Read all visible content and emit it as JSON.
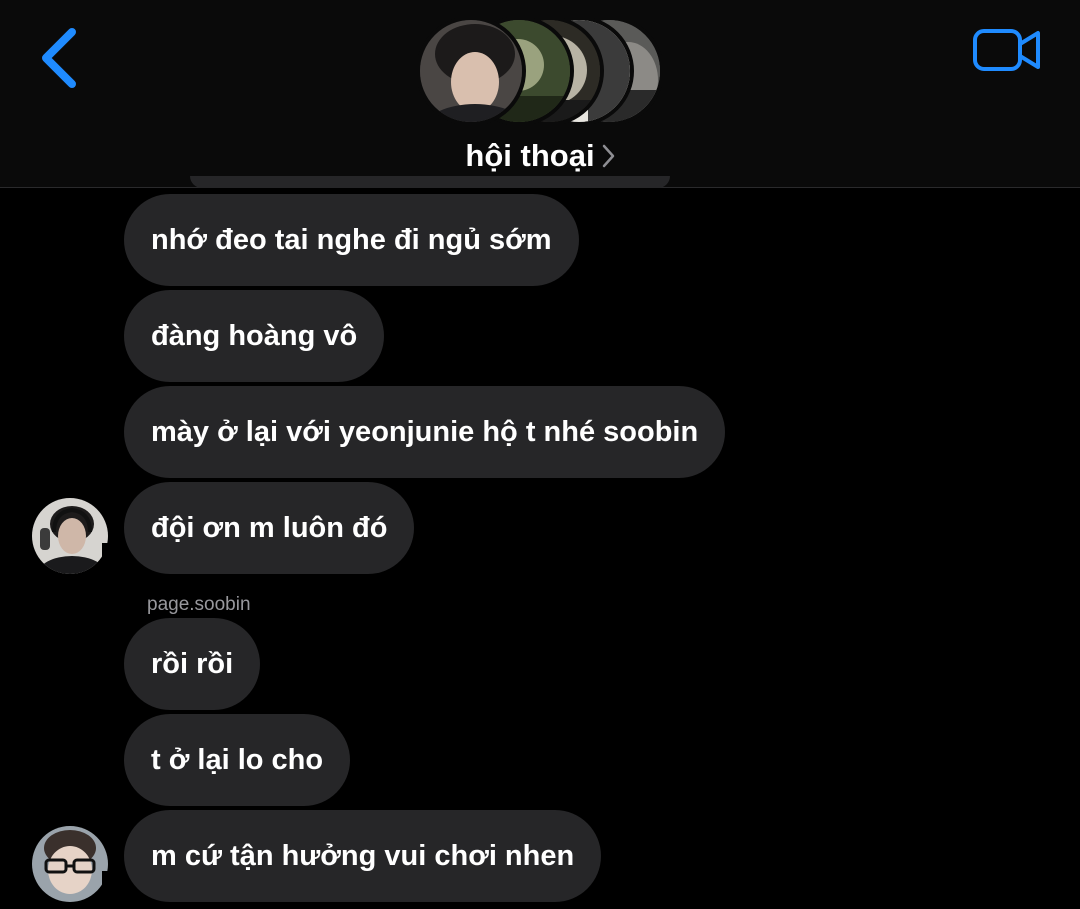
{
  "header": {
    "title": "hội thoại",
    "back_icon": "chevron-left-icon",
    "video_icon": "video-camera-icon",
    "accent_color": "#1f8bff"
  },
  "messages": [
    {
      "text": "nhớ đeo tai nghe đi ngủ sớm"
    },
    {
      "text": "đàng hoàng vô"
    },
    {
      "text": "mày ở lại với yeonjunie hộ t nhé soobin"
    },
    {
      "text": "đội ơn m luôn đó"
    },
    {
      "text": "rồi rồi"
    },
    {
      "text": "t ở lại lo cho"
    },
    {
      "text": "m cứ tận hưởng vui chơi nhen"
    }
  ],
  "sender_label": "page.soobin",
  "colors": {
    "bubble": "#262628",
    "background": "#000000",
    "sender_label": "#98989d"
  }
}
